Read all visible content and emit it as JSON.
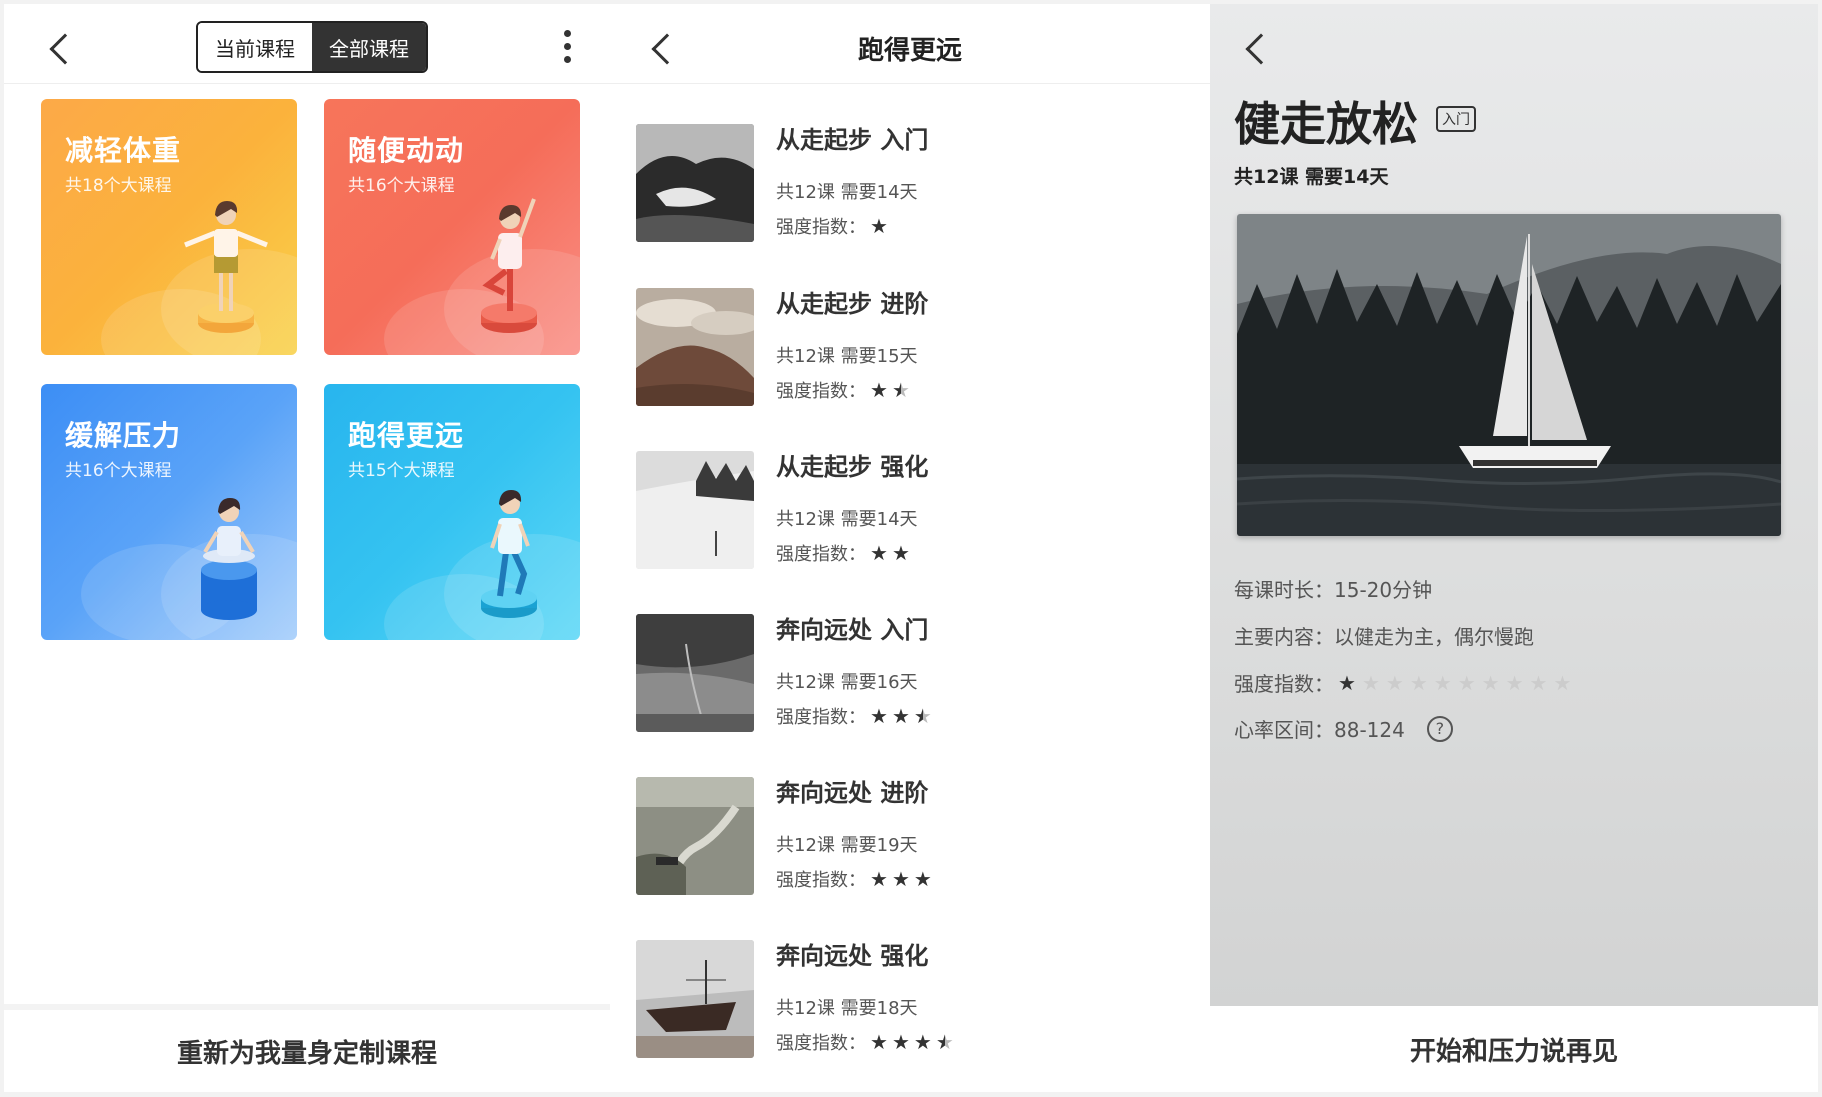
{
  "panel_all_courses": {
    "seg_current": "当前课程",
    "seg_all": "全部课程",
    "cards": [
      {
        "title": "减轻体重",
        "subtitle": "共18个大课程"
      },
      {
        "title": "随便动动",
        "subtitle": "共16个大课程"
      },
      {
        "title": "缓解压力",
        "subtitle": "共16个大课程"
      },
      {
        "title": "跑得更远",
        "subtitle": "共15个大课程"
      }
    ],
    "bottom_button": "重新为我量身定制课程"
  },
  "panel_course_list": {
    "title": "跑得更远",
    "intensity_label": "强度指数：",
    "items": [
      {
        "title": "从走起步 入门",
        "meta": "共12课 需要14天",
        "intensity": 1
      },
      {
        "title": "从走起步 进阶",
        "meta": "共12课 需要15天",
        "intensity": 1.5
      },
      {
        "title": "从走起步 强化",
        "meta": "共12课 需要14天",
        "intensity": 2
      },
      {
        "title": "奔向远处 入门",
        "meta": "共12课 需要16天",
        "intensity": 2.5
      },
      {
        "title": "奔向远处 进阶",
        "meta": "共12课 需要19天",
        "intensity": 3
      },
      {
        "title": "奔向远处 强化",
        "meta": "共12课 需要18天",
        "intensity": 3.5
      }
    ]
  },
  "panel_detail": {
    "title": "健走放松",
    "badge": "入门",
    "subtitle": "共12课 需要14天",
    "duration": "每课时长：15-20分钟",
    "content": "主要内容：以健走为主，偶尔慢跑",
    "intensity_label": "强度指数：",
    "intensity": 1,
    "intensity_max": 10,
    "heart_rate": "心率区间：88-124",
    "help_icon": "?",
    "bottom_button": "开始和压力说再见"
  }
}
